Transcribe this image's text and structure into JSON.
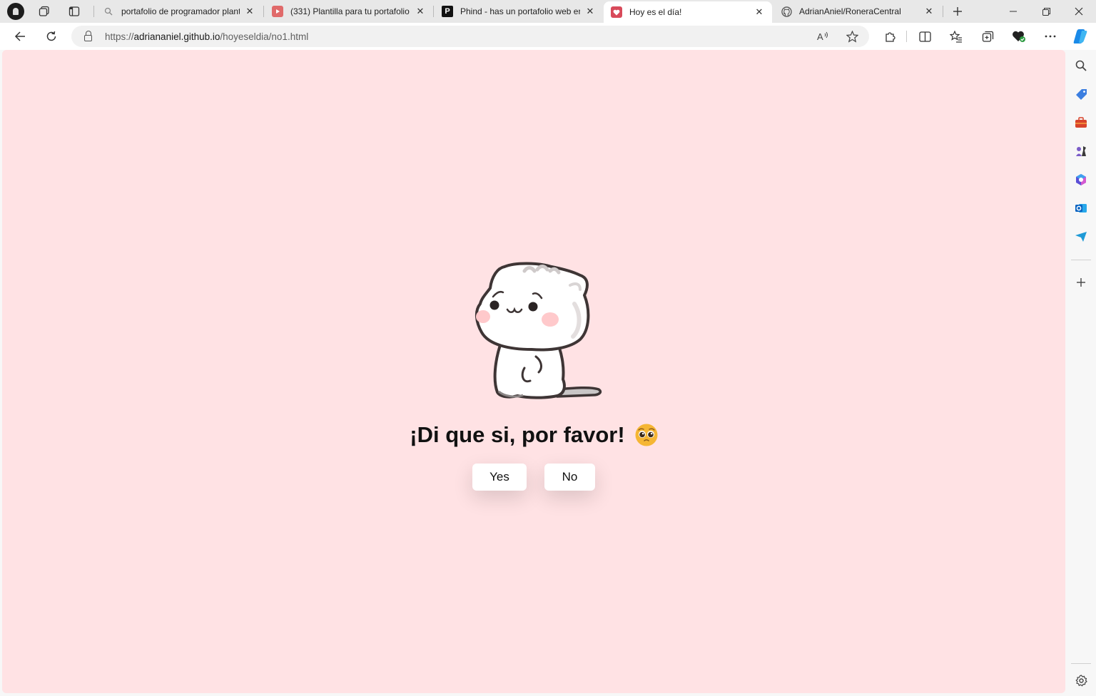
{
  "browser": {
    "tabs": [
      {
        "title": "portafolio de programador plant",
        "favicon": "search-icon",
        "active": false
      },
      {
        "title": "(331) Plantilla para tu portafolio",
        "favicon": "youtube-icon",
        "active": false
      },
      {
        "title": "Phind - has un portafolio web en",
        "favicon": "phind-icon",
        "active": false
      },
      {
        "title": "Hoy es el día!",
        "favicon": "heart-icon",
        "active": true
      },
      {
        "title": "AdrianAniel/RoneraCentral",
        "favicon": "github-icon",
        "active": false
      }
    ],
    "address": {
      "scheme": "https://",
      "host": "adriananiel.github.io",
      "path": "/hoyeseldia/no1.html"
    },
    "window_controls": {
      "minimize": "—",
      "restore": "❐",
      "close": "✕"
    }
  },
  "page": {
    "headline": "¡Di que si, por favor!",
    "yes_label": "Yes",
    "no_label": "No",
    "background": "#ffe2e4"
  }
}
